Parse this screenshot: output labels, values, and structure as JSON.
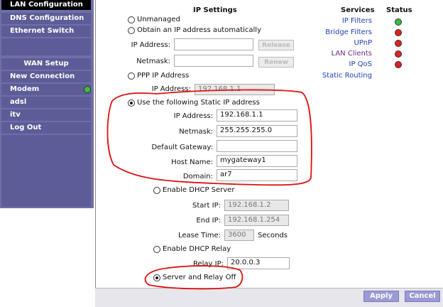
{
  "sidebar": {
    "items": [
      {
        "label": "LAN Configuration",
        "active": true
      },
      {
        "label": "DNS Configuration"
      },
      {
        "label": "Ethernet Switch"
      },
      {
        "label": "WAN Setup",
        "section": true
      },
      {
        "label": "New Connection"
      },
      {
        "label": "Modem",
        "status": "green"
      },
      {
        "label": "adsl"
      },
      {
        "label": "itv"
      },
      {
        "label": "Log Out"
      }
    ]
  },
  "ip_settings": {
    "title": "IP Settings",
    "unmanaged_label": "Unmanaged",
    "obtain_auto_label": "Obtain an IP address automatically",
    "auto_ip_label": "IP Address:",
    "auto_ip_value": "",
    "release_label": "Release",
    "auto_netmask_label": "Netmask:",
    "auto_netmask_value": "",
    "renew_label": "Renew",
    "ppp_label": "PPP IP Address",
    "ppp_ip_label": "IP Address:",
    "ppp_ip_value": "192.168.1.1",
    "static_label": "Use the following Static IP address",
    "static_ip_label": "IP Address:",
    "static_ip_value": "192.168.1.1",
    "static_netmask_label": "Netmask:",
    "static_netmask_value": "255.255.255.0",
    "gateway_label": "Default Gateway:",
    "gateway_value": "",
    "hostname_label": "Host Name:",
    "hostname_value": "mygateway1",
    "domain_label": "Domain:",
    "domain_value": "ar7",
    "selected_mode": "static"
  },
  "dhcp": {
    "server_label": "Enable DHCP Server",
    "start_ip_label": "Start IP:",
    "start_ip_value": "192.168.1.2",
    "end_ip_label": "End IP:",
    "end_ip_value": "192.168.1.254",
    "lease_label": "Lease Time:",
    "lease_value": "3600",
    "lease_unit": "Seconds",
    "relay_label": "Enable DHCP Relay",
    "relay_ip_label": "Relay IP:",
    "relay_ip_value": "20.0.0.3",
    "off_label": "Server and Relay Off",
    "selected_mode": "off"
  },
  "services": {
    "header": "Services",
    "status_header": "Status",
    "items": [
      {
        "label": "IP Filters",
        "status": "green"
      },
      {
        "label": "Bridge Filters",
        "status": "red"
      },
      {
        "label": "UPnP",
        "status": "red"
      },
      {
        "label": "LAN Clients",
        "status": "red"
      },
      {
        "label": "IP QoS",
        "status": "red"
      },
      {
        "label": "Static Routing"
      }
    ]
  },
  "footer": {
    "apply_label": "Apply",
    "cancel_label": "Cancel"
  },
  "colors": {
    "sidebar_bg": "#6f6fa8",
    "nav_item_bg": "#5c5c98",
    "link_blue": "#1f3fb5",
    "annotation_red": "#e01010",
    "button_bg": "#9a9ad4"
  }
}
